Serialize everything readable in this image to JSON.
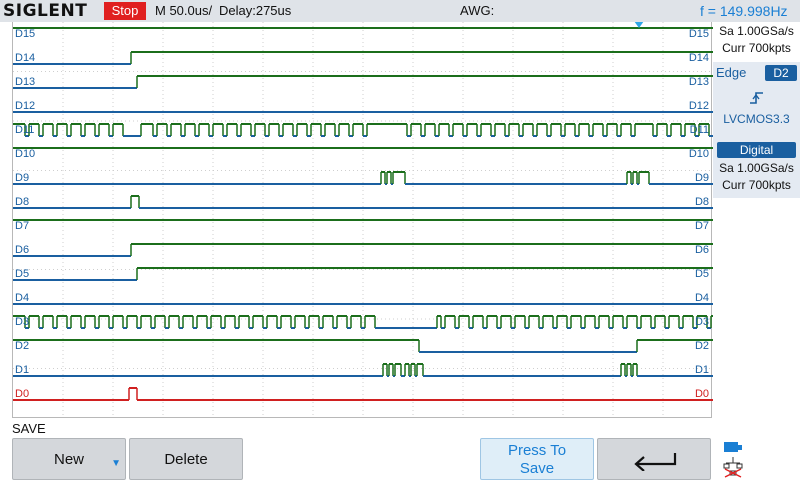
{
  "header": {
    "brand": "SIGLENT",
    "run_state": "Stop",
    "timebase": "M 50.0us/",
    "delay": "Delay:275us",
    "awg": "AWG:",
    "frequency": "f = 149.998Hz"
  },
  "channels": [
    {
      "name": "D15",
      "color": "#1a5fa0"
    },
    {
      "name": "D14",
      "color": "#1a5fa0"
    },
    {
      "name": "D13",
      "color": "#1a5fa0"
    },
    {
      "name": "D12",
      "color": "#1a5fa0"
    },
    {
      "name": "D11",
      "color": "#1a5fa0"
    },
    {
      "name": "D10",
      "color": "#1a5fa0"
    },
    {
      "name": "D9",
      "color": "#1a5fa0"
    },
    {
      "name": "D8",
      "color": "#1a5fa0"
    },
    {
      "name": "D7",
      "color": "#1a5fa0"
    },
    {
      "name": "D6",
      "color": "#1a5fa0"
    },
    {
      "name": "D5",
      "color": "#1a5fa0"
    },
    {
      "name": "D4",
      "color": "#1a5fa0"
    },
    {
      "name": "D3",
      "color": "#1a5fa0"
    },
    {
      "name": "D2",
      "color": "#1a5fa0"
    },
    {
      "name": "D1",
      "color": "#1a5fa0"
    },
    {
      "name": "D0",
      "color": "#d02020"
    }
  ],
  "colors": {
    "high": "#1b6e1b",
    "low": "#1a5fa0",
    "d0": "#d02020",
    "accent": "#1a7fd4",
    "stop": "#e02020"
  },
  "acquisition": {
    "sample_rate": "Sa 1.00GSa/s",
    "memory": "Curr 700kpts"
  },
  "trigger": {
    "type": "Edge",
    "source": "D2",
    "slope_icon": "rising-edge-icon",
    "level": "LVCMOS3.3"
  },
  "digital": {
    "title": "Digital",
    "sample_rate": "Sa 1.00GSa/s",
    "memory": "Curr 700kpts"
  },
  "menu": {
    "title": "SAVE",
    "new_label": "New",
    "delete_label": "Delete",
    "press_line1": "Press To",
    "press_line2": "Save",
    "back_icon": "return-arrow-icon",
    "network_icon": "network-icon"
  }
}
